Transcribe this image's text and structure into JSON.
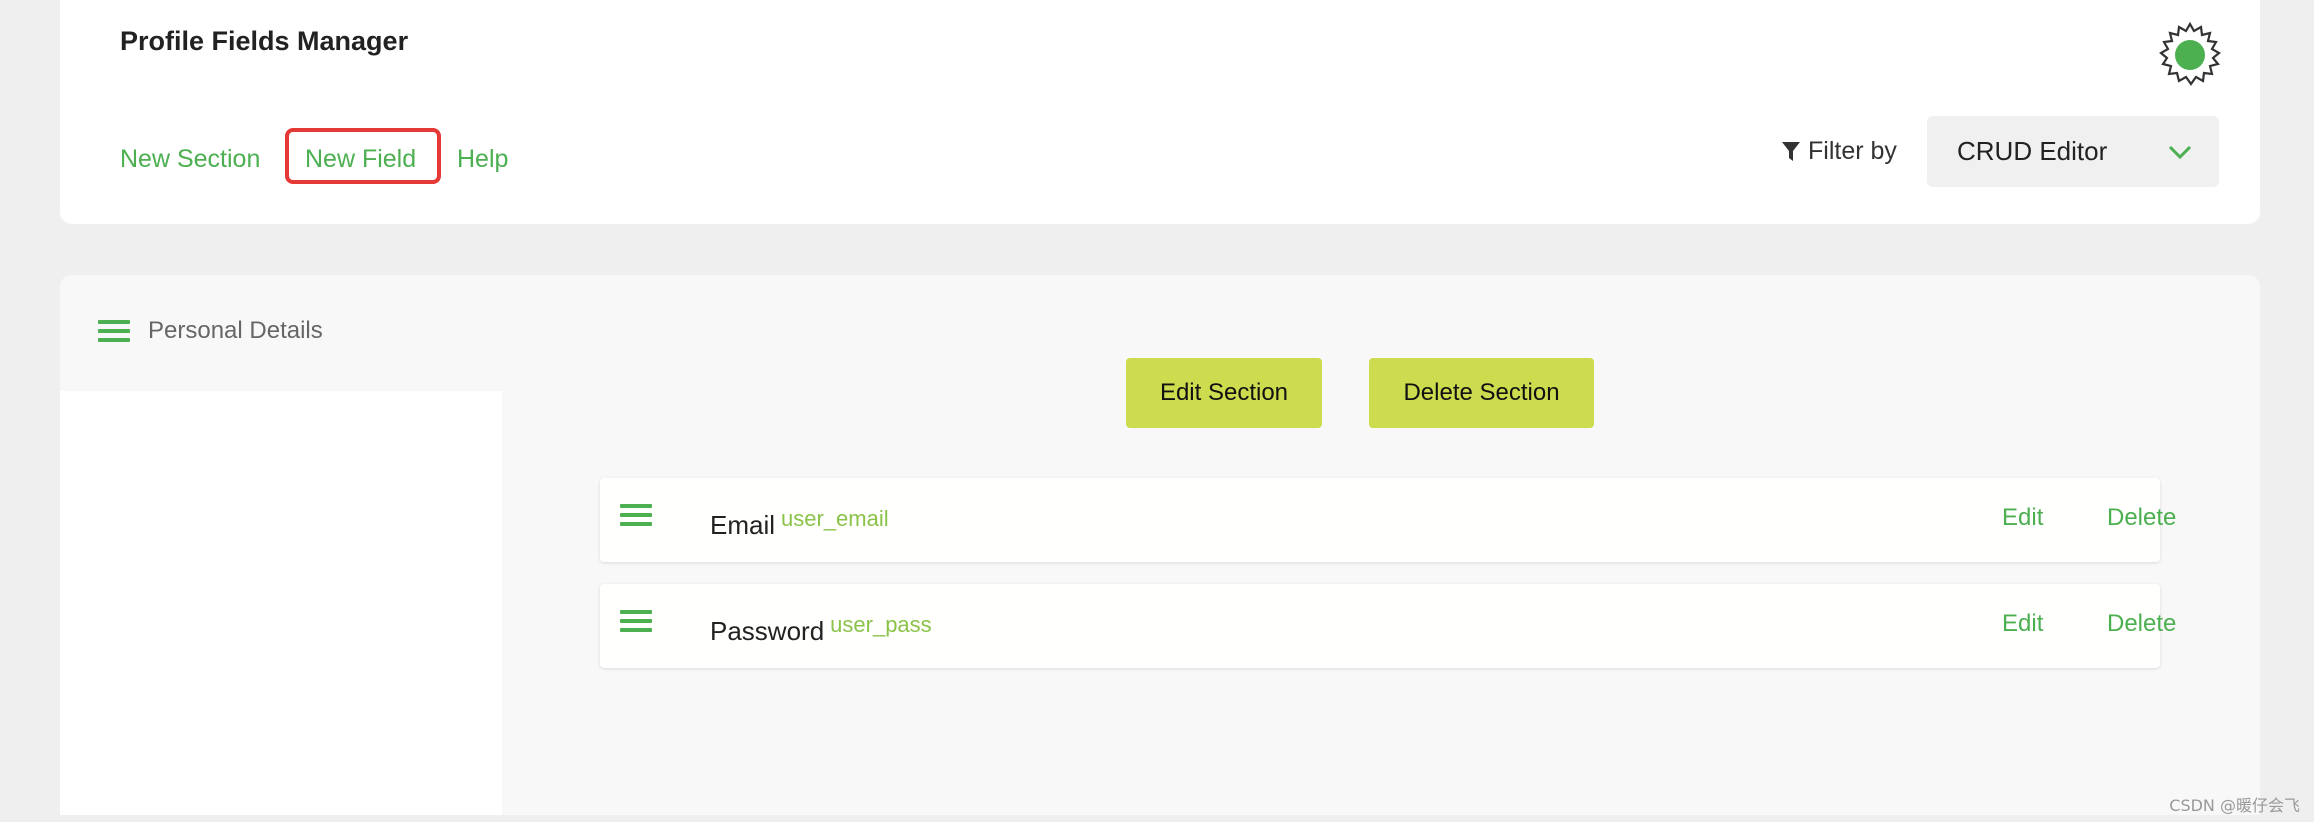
{
  "header": {
    "title": "Profile Fields Manager",
    "links": {
      "new_section": "New Section",
      "new_field": "New Field",
      "help": "Help"
    },
    "settings_icon": "gear-icon",
    "filter": {
      "label": "Filter by",
      "icon": "filter-icon",
      "selected": "CRUD Editor"
    }
  },
  "section": {
    "name": "Personal Details",
    "edit_label": "Edit Section",
    "delete_label": "Delete Section",
    "fields": [
      {
        "name": "Email",
        "key": "user_email",
        "edit": "Edit",
        "delete": "Delete"
      },
      {
        "name": "Password",
        "key": "user_pass",
        "edit": "Edit",
        "delete": "Delete"
      }
    ]
  },
  "watermark": "CSDN @暖仔会飞",
  "colors": {
    "accent": "#4caf50",
    "button": "#cddc4e",
    "key_text": "#8bc34a",
    "highlight": "#e53935"
  }
}
